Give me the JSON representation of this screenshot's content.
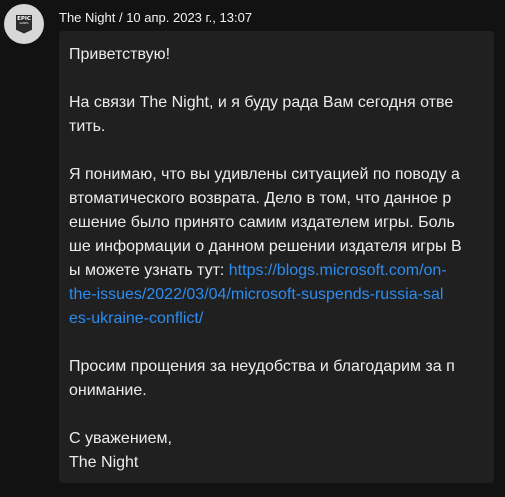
{
  "author": {
    "avatar_logo_top": "EPIC",
    "avatar_logo_bottom": "GAMES"
  },
  "message": {
    "meta": "The Night / 10 апр. 2023 г., 13:07",
    "greeting": "Приветствую!",
    "intro_line1": "На связи The Night, и я буду рада Вам сегодня отве",
    "intro_line2": "тить.",
    "body_line1": "Я понимаю, что вы удивлены ситуацией по поводу а",
    "body_line2": "втоматического возврата. Дело в том, что данное р",
    "body_line3": "ешение было принято самим издателем игры. Боль",
    "body_line4": "ше информации о данном решении издателя игры В",
    "body_line5_text": "ы можете узнать тут: ",
    "link_line1": "https://blogs.microsoft.com/on-",
    "link_line2": "the-issues/2022/03/04/microsoft-suspends-russia-sal",
    "link_line3": "es-ukraine-conflict/",
    "apology_line1": "Просим прощения за неудобства и благодарим за п",
    "apology_line2": "онимание.",
    "signoff": "С уважением,",
    "signature": "The Night"
  },
  "colors": {
    "background": "#121212",
    "bubble": "#202020",
    "text": "#ececec",
    "link": "#2c8cf0",
    "avatar_bg": "#d7d7d7"
  }
}
